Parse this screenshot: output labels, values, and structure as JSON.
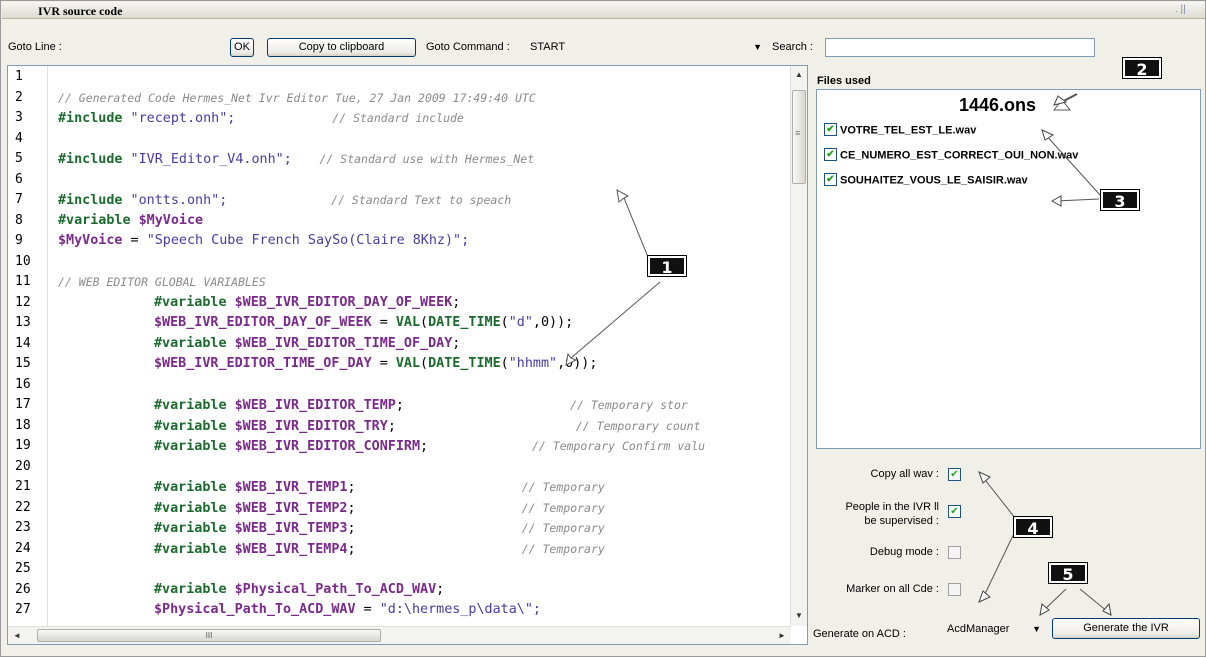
{
  "window": {
    "title": "IVR source code",
    "controls": ". ||"
  },
  "toolbar": {
    "goto_line_label": "Goto Line :",
    "goto_line_value": "",
    "ok_label": "OK",
    "copy_label": "Copy to clipboard",
    "goto_command_label": "Goto Command :",
    "goto_command_value": "START",
    "search_label": "Search :",
    "search_value": ""
  },
  "editor": {
    "line_numbers": [
      "1",
      "2",
      "3",
      "4",
      "5",
      "6",
      "7",
      "8",
      "9",
      "10",
      "11",
      "12",
      "13",
      "14",
      "15",
      "16",
      "17",
      "18",
      "19",
      "20",
      "21",
      "22",
      "23",
      "24",
      "25",
      "26",
      "27"
    ],
    "lines": [
      {
        "indent": 0,
        "tokens": []
      },
      {
        "indent": 0,
        "tokens": [
          {
            "t": "cm",
            "v": "// Generated Code Hermes_Net Ivr Editor Tue, 27 Jan 2009 17:49:40 UTC"
          }
        ]
      },
      {
        "indent": 0,
        "tokens": [
          {
            "t": "kw",
            "v": "#include"
          },
          {
            "t": "str",
            "v": " \"recept.onh\";"
          },
          {
            "t": "cm",
            "v": "              // Standard include"
          }
        ]
      },
      {
        "indent": 0,
        "tokens": []
      },
      {
        "indent": 0,
        "tokens": [
          {
            "t": "kw",
            "v": "#include"
          },
          {
            "t": "str",
            "v": " \"IVR_Editor_V4.onh\";"
          },
          {
            "t": "cm",
            "v": "    // Standard use with Hermes_Net"
          }
        ]
      },
      {
        "indent": 0,
        "tokens": []
      },
      {
        "indent": 0,
        "tokens": [
          {
            "t": "kw",
            "v": "#include"
          },
          {
            "t": "str",
            "v": " \"ontts.onh\";"
          },
          {
            "t": "cm",
            "v": "               // Standard Text to speach"
          }
        ]
      },
      {
        "indent": 0,
        "tokens": [
          {
            "t": "kw",
            "v": "#variable"
          },
          {
            "t": "var",
            "v": " $MyVoice"
          }
        ]
      },
      {
        "indent": 0,
        "tokens": [
          {
            "t": "var",
            "v": "$MyVoice"
          },
          {
            "t": "dk",
            "v": " = "
          },
          {
            "t": "str",
            "v": "\"Speech Cube French SaySo(Claire 8Khz)\";"
          }
        ]
      },
      {
        "indent": 0,
        "tokens": []
      },
      {
        "indent": 0,
        "tokens": [
          {
            "t": "cm",
            "v": "// WEB EDITOR GLOBAL VARIABLES"
          }
        ]
      },
      {
        "indent": 1,
        "tokens": [
          {
            "t": "kw",
            "v": "#variable"
          },
          {
            "t": "var",
            "v": " $WEB_IVR_EDITOR_DAY_OF_WEEK"
          },
          {
            "t": "dk",
            "v": ";"
          }
        ]
      },
      {
        "indent": 1,
        "tokens": [
          {
            "t": "var",
            "v": "$WEB_IVR_EDITOR_DAY_OF_WEEK"
          },
          {
            "t": "dk",
            "v": " = "
          },
          {
            "t": "fn",
            "v": "VAL"
          },
          {
            "t": "dk",
            "v": "("
          },
          {
            "t": "fn",
            "v": "DATE_TIME"
          },
          {
            "t": "dk",
            "v": "("
          },
          {
            "t": "str",
            "v": "\"d\""
          },
          {
            "t": "dk",
            "v": ",0));"
          }
        ]
      },
      {
        "indent": 1,
        "tokens": [
          {
            "t": "kw",
            "v": "#variable"
          },
          {
            "t": "var",
            "v": " $WEB_IVR_EDITOR_TIME_OF_DAY"
          },
          {
            "t": "dk",
            "v": ";"
          }
        ]
      },
      {
        "indent": 1,
        "tokens": [
          {
            "t": "var",
            "v": "$WEB_IVR_EDITOR_TIME_OF_DAY"
          },
          {
            "t": "dk",
            "v": " = "
          },
          {
            "t": "fn",
            "v": "VAL"
          },
          {
            "t": "dk",
            "v": "("
          },
          {
            "t": "fn",
            "v": "DATE_TIME"
          },
          {
            "t": "dk",
            "v": "("
          },
          {
            "t": "str",
            "v": "\"hhmm\""
          },
          {
            "t": "dk",
            "v": ",0));"
          }
        ]
      },
      {
        "indent": 0,
        "tokens": []
      },
      {
        "indent": 1,
        "tokens": [
          {
            "t": "kw",
            "v": "#variable"
          },
          {
            "t": "var",
            "v": " $WEB_IVR_EDITOR_TEMP"
          },
          {
            "t": "dk",
            "v": ";"
          },
          {
            "t": "cm",
            "v": "                        // Temporary stor"
          }
        ]
      },
      {
        "indent": 1,
        "tokens": [
          {
            "t": "kw",
            "v": "#variable"
          },
          {
            "t": "var",
            "v": " $WEB_IVR_EDITOR_TRY"
          },
          {
            "t": "dk",
            "v": ";"
          },
          {
            "t": "cm",
            "v": "                          // Temporary count"
          }
        ]
      },
      {
        "indent": 1,
        "tokens": [
          {
            "t": "kw",
            "v": "#variable"
          },
          {
            "t": "var",
            "v": " $WEB_IVR_EDITOR_CONFIRM"
          },
          {
            "t": "dk",
            "v": ";"
          },
          {
            "t": "cm",
            "v": "               // Temporary Confirm valu"
          }
        ]
      },
      {
        "indent": 0,
        "tokens": []
      },
      {
        "indent": 1,
        "tokens": [
          {
            "t": "kw",
            "v": "#variable"
          },
          {
            "t": "var",
            "v": " $WEB_IVR_TEMP1"
          },
          {
            "t": "dk",
            "v": ";"
          },
          {
            "t": "cm",
            "v": "                        // Temporary"
          }
        ]
      },
      {
        "indent": 1,
        "tokens": [
          {
            "t": "kw",
            "v": "#variable"
          },
          {
            "t": "var",
            "v": " $WEB_IVR_TEMP2"
          },
          {
            "t": "dk",
            "v": ";"
          },
          {
            "t": "cm",
            "v": "                        // Temporary"
          }
        ]
      },
      {
        "indent": 1,
        "tokens": [
          {
            "t": "kw",
            "v": "#variable"
          },
          {
            "t": "var",
            "v": " $WEB_IVR_TEMP3"
          },
          {
            "t": "dk",
            "v": ";"
          },
          {
            "t": "cm",
            "v": "                        // Temporary"
          }
        ]
      },
      {
        "indent": 1,
        "tokens": [
          {
            "t": "kw",
            "v": "#variable"
          },
          {
            "t": "var",
            "v": " $WEB_IVR_TEMP4"
          },
          {
            "t": "dk",
            "v": ";"
          },
          {
            "t": "cm",
            "v": "                        // Temporary"
          }
        ]
      },
      {
        "indent": 0,
        "tokens": []
      },
      {
        "indent": 1,
        "tokens": [
          {
            "t": "kw",
            "v": "#variable"
          },
          {
            "t": "var",
            "v": " $Physical_Path_To_ACD_WAV"
          },
          {
            "t": "dk",
            "v": ";"
          }
        ]
      },
      {
        "indent": 1,
        "tokens": [
          {
            "t": "var",
            "v": "$Physical_Path_To_ACD_WAV"
          },
          {
            "t": "dk",
            "v": " = "
          },
          {
            "t": "str",
            "v": "\"d:\\hermes_p\\data\\\";"
          }
        ]
      }
    ],
    "hscroll_thumb_glyph": "III"
  },
  "files": {
    "label": "Files used",
    "ons_file": "1446.ons",
    "items": [
      {
        "name": "VOTRE_TEL_EST_LE.wav",
        "checked": true
      },
      {
        "name": "CE_NUMERO_EST_CORRECT_OUI_NON.wav",
        "checked": true
      },
      {
        "name": "SOUHAITEZ_VOUS_LE_SAISIR.wav",
        "checked": true
      }
    ]
  },
  "options": {
    "copy_all_wav_label": "Copy all wav :",
    "copy_all_wav": true,
    "supervised_label_1": "People in the IVR ll",
    "supervised_label_2": "be supervised :",
    "supervised": true,
    "debug_label": "Debug mode :",
    "debug": false,
    "marker_label": "Marker on all Cde :",
    "marker": false,
    "generate_on_acd_label": "Generate on ACD :",
    "acd_value": "AcdManager",
    "generate_button": "Generate the IVR"
  },
  "callouts": [
    "1",
    "2",
    "3",
    "4",
    "5"
  ],
  "colors": {
    "callout_bg": "#111111",
    "keyword": "#1b6a2e",
    "variable": "#7a2a8a",
    "string": "#4c3aa0",
    "comment": "#8a8a8a"
  }
}
